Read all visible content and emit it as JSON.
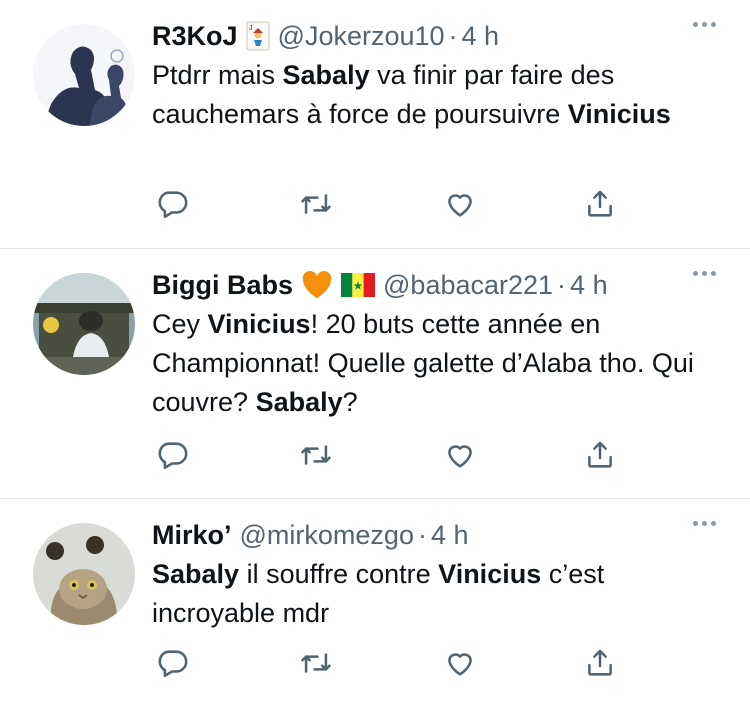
{
  "tweets": [
    {
      "name": "R3KoJ",
      "badge_icon": "joker-card-icon",
      "handle": "@Jokerzou10",
      "separator": "·",
      "time": "4 h",
      "body": [
        {
          "t": "Ptdrr mais ",
          "b": false
        },
        {
          "t": "Sabaly",
          "b": true
        },
        {
          "t": " va finir par faire des cauchemars à force de poursuivre ",
          "b": false
        },
        {
          "t": "Vinicius",
          "b": true
        }
      ]
    },
    {
      "name": "Biggi Babs",
      "badge_icon": "orange-heart-icon",
      "badge_icon_2": "senegal-flag-icon",
      "handle": "@babacar221",
      "separator": "·",
      "time": "4 h",
      "body": [
        {
          "t": "Cey ",
          "b": false
        },
        {
          "t": "Vinicius",
          "b": true
        },
        {
          "t": "! 20 buts cette année en Championnat! Quelle galette d’Alaba tho. Qui couvre? ",
          "b": false
        },
        {
          "t": "Sabaly",
          "b": true
        },
        {
          "t": "?",
          "b": false
        }
      ]
    },
    {
      "name": "Mirko’",
      "handle": "@mirkomezgo",
      "separator": "·",
      "time": "4 h",
      "body": [
        {
          "t": "Sabaly",
          "b": true
        },
        {
          "t": " il souffre contre ",
          "b": false
        },
        {
          "t": "Vinicius",
          "b": true
        },
        {
          "t": " c’est incroyable mdr",
          "b": false
        }
      ]
    }
  ],
  "action_icons": [
    "reply-icon",
    "retweet-icon",
    "like-icon",
    "share-icon"
  ],
  "colors": {
    "text": "#0f1419",
    "secondary": "#536471",
    "icon": "#536471",
    "divider": "#e3e6e8"
  }
}
